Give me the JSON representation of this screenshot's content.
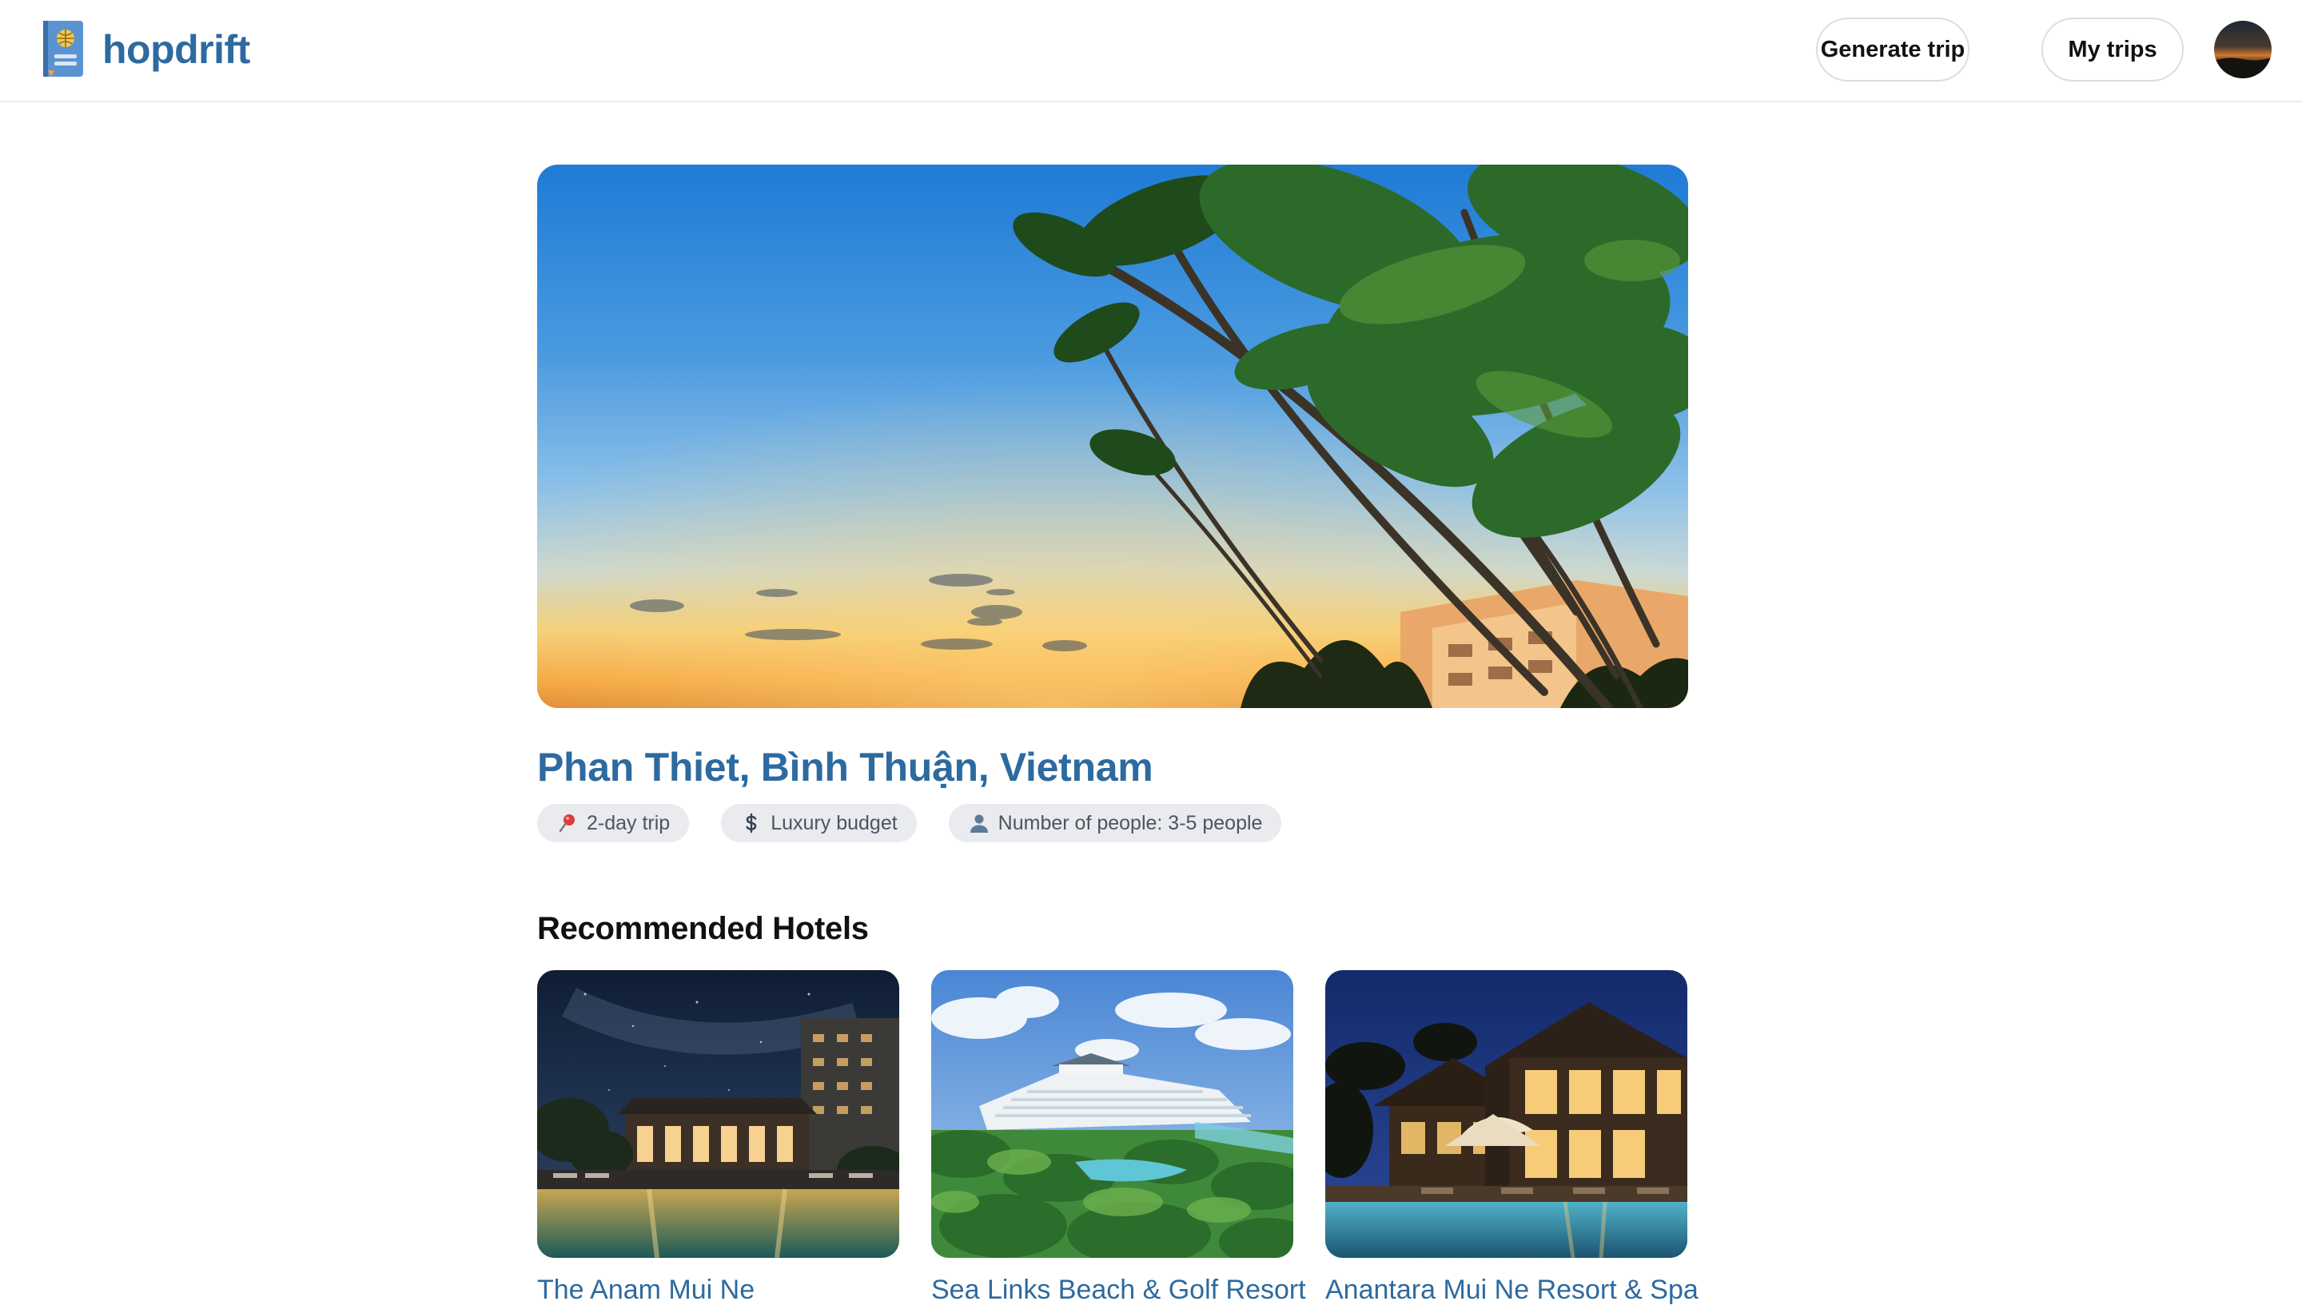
{
  "app": {
    "name": "hopdrift",
    "brand_color": "#2d6aa0"
  },
  "header": {
    "generate_label": "Generate trip",
    "mytrips_label": "My trips"
  },
  "trip": {
    "title": "Phan Thiet, Bình Thuận, Vietnam",
    "chips": [
      {
        "icon": "pushpin-icon",
        "label": "2-day trip"
      },
      {
        "icon": "dollar-icon",
        "label": "Luxury budget"
      },
      {
        "icon": "person-icon",
        "label": "Number of people: 3-5 people"
      }
    ]
  },
  "hotels": {
    "section_title": "Recommended Hotels",
    "items": [
      {
        "name": "The Anam Mui Ne"
      },
      {
        "name": "Sea Links Beach & Golf Resort"
      },
      {
        "name": "Anantara Mui Ne Resort & Spa"
      }
    ]
  }
}
